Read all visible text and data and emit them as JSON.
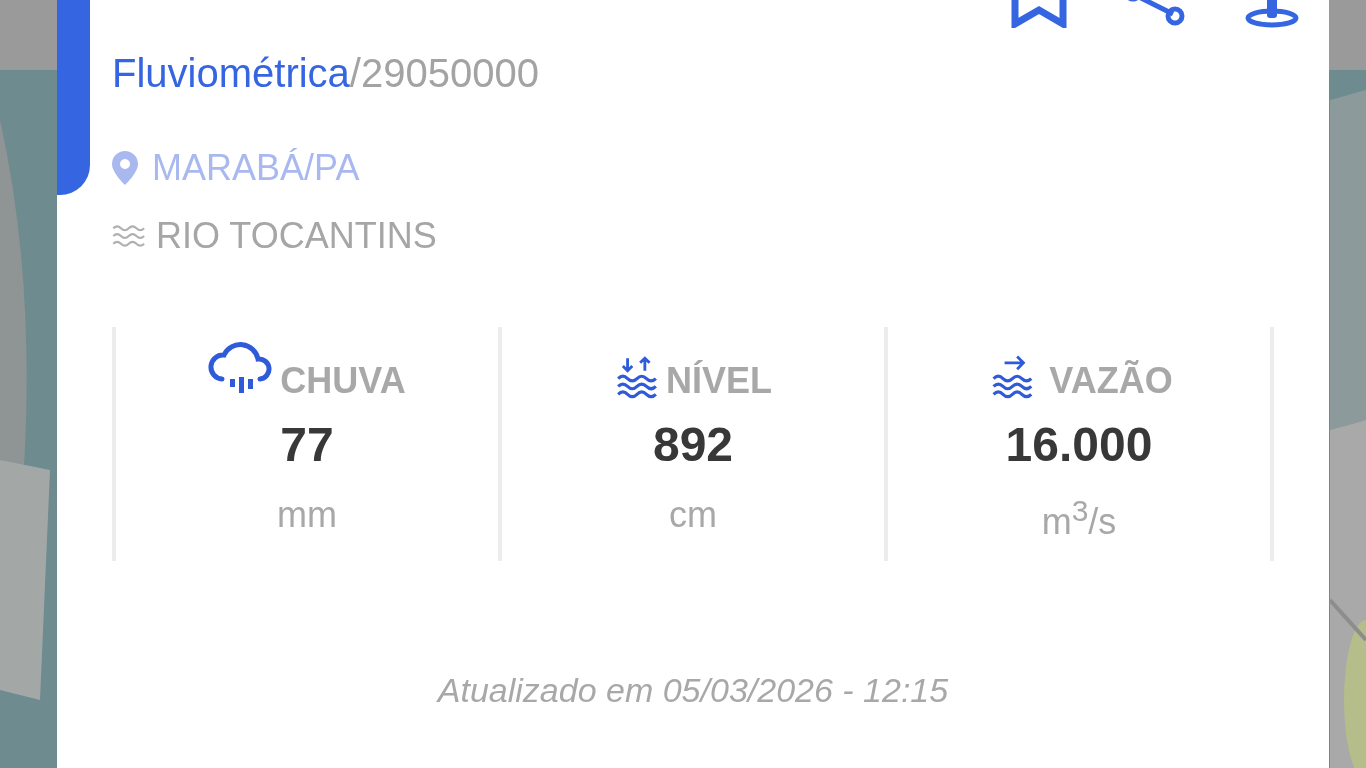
{
  "station": {
    "type": "Fluviométrica",
    "code": "/29050000",
    "location": "MARABÁ/PA",
    "river": "RIO TOCANTINS"
  },
  "metrics": [
    {
      "kind": "rain",
      "label": "CHUVA",
      "value": "77",
      "unit": "mm"
    },
    {
      "kind": "level",
      "label": "NÍVEL",
      "value": "892",
      "unit": "cm"
    },
    {
      "kind": "flow",
      "label": "VAZÃO",
      "value": "16.000",
      "unit": "m$^{3}$/s"
    }
  ],
  "updated": "Atualizado em 05/03/2026 - 12:15"
}
